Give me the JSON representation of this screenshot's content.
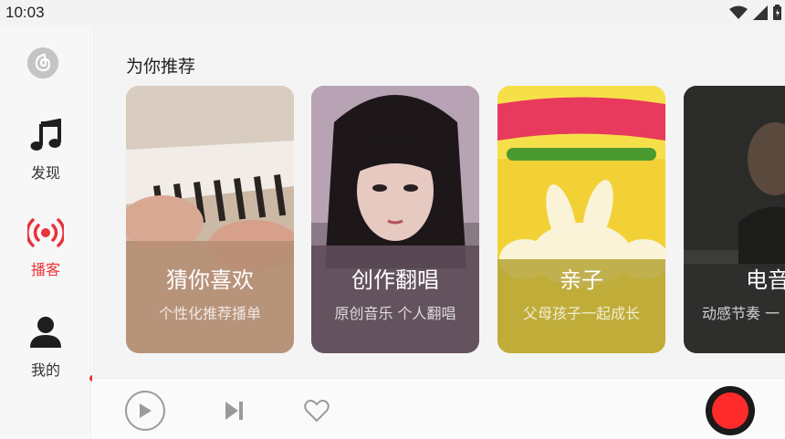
{
  "status_bar": {
    "time": "10:03",
    "icons": [
      "wifi-icon",
      "cellular-signal-icon",
      "battery-icon"
    ]
  },
  "sidebar": {
    "logo_icon": "netease-music-logo-icon",
    "items": [
      {
        "label": "发现",
        "icon": "music-note-icon",
        "active": false
      },
      {
        "label": "播客",
        "icon": "broadcast-icon",
        "active": true
      },
      {
        "label": "我的",
        "icon": "person-icon",
        "active": false
      }
    ],
    "accent_color": "#e8333a"
  },
  "main": {
    "section_title": "为你推荐",
    "cards": [
      {
        "title": "猜你喜欢",
        "subtitle": "个性化推荐播单",
        "tint": "#a98a74"
      },
      {
        "title": "创作翻唱",
        "subtitle": "原创音乐 个人翻唱",
        "tint": "#6e5d66"
      },
      {
        "title": "亲子",
        "subtitle": "父母孩子一起成长",
        "tint": "#b8a63a"
      },
      {
        "title": "电音",
        "subtitle": "动感节奏 一",
        "tint": "#3a3a3a"
      }
    ]
  },
  "player": {
    "play_icon": "play-icon",
    "next_icon": "skip-next-icon",
    "like_icon": "heart-icon",
    "record_icon": "record-icon"
  }
}
